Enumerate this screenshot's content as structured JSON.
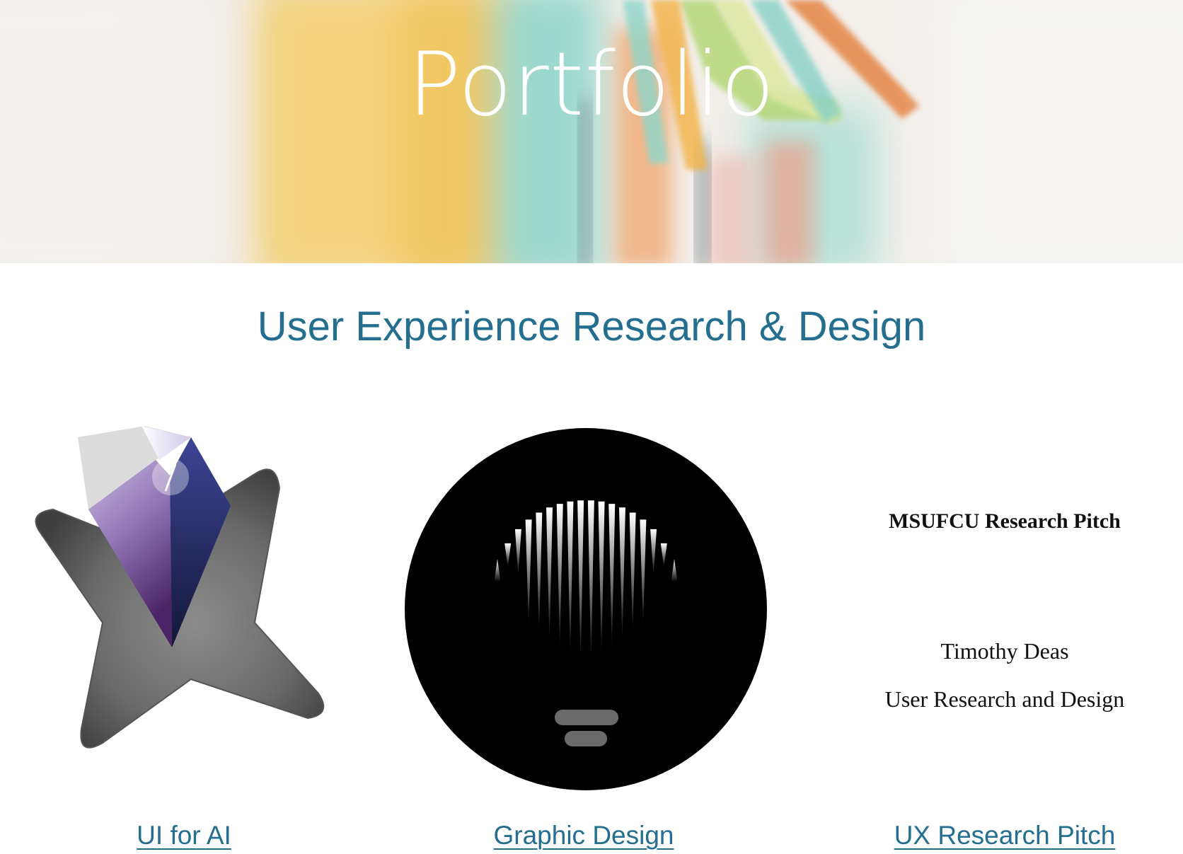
{
  "hero": {
    "title": "Portfolio"
  },
  "section": {
    "title": "User Experience Research & Design"
  },
  "cards": [
    {
      "link_label": "UI for AI",
      "thumbnail_icon": "crystal-star-icon"
    },
    {
      "link_label": "Graphic Design",
      "thumbnail_icon": "lightbulb-icon"
    },
    {
      "link_label": "UX Research Pitch",
      "document": {
        "title": "MSUFCU Research Pitch",
        "author": "Timothy Deas",
        "role": "User Research and Design"
      }
    }
  ],
  "colors": {
    "heading": "#246e8f",
    "link": "#246e8f",
    "hero_text": "#ffffff"
  }
}
